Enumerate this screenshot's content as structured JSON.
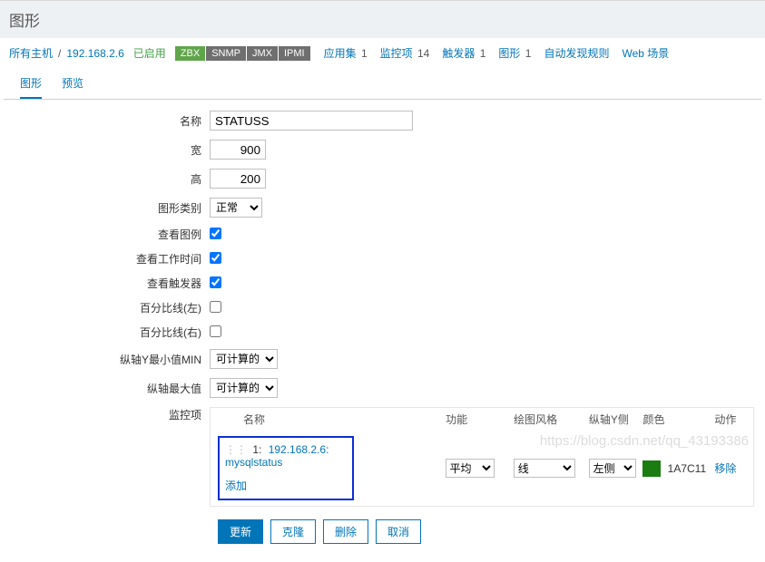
{
  "page": {
    "title": "图形"
  },
  "breadcrumb": {
    "all_hosts": "所有主机",
    "host": "192.168.2.6",
    "enabled": "已启用",
    "proto": {
      "zbx": "ZBX",
      "snmp": "SNMP",
      "jmx": "JMX",
      "ipmi": "IPMI"
    },
    "navs": [
      {
        "label": "应用集",
        "count": "1"
      },
      {
        "label": "监控项",
        "count": "14"
      },
      {
        "label": "触发器",
        "count": "1"
      },
      {
        "label": "图形",
        "count": "1"
      },
      {
        "label": "自动发现规则",
        "count": ""
      },
      {
        "label": "Web 场景",
        "count": ""
      }
    ]
  },
  "tabs": {
    "graph": "图形",
    "preview": "预览"
  },
  "form": {
    "name_label": "名称",
    "name_value": "STATUSS",
    "width_label": "宽",
    "width_value": "900",
    "height_label": "高",
    "height_value": "200",
    "type_label": "图形类别",
    "type_value": "正常",
    "show_legend_label": "查看图例",
    "show_worktime_label": "查看工作时间",
    "show_triggers_label": "查看触发器",
    "percent_left_label": "百分比线(左)",
    "percent_right_label": "百分比线(右)",
    "yaxis_min_label": "纵轴Y最小值MIN",
    "yaxis_min_value": "可计算的",
    "yaxis_max_label": "纵轴最大值",
    "yaxis_max_value": "可计算的",
    "items_label": "监控项"
  },
  "items": {
    "headers": {
      "name": "名称",
      "func": "功能",
      "style": "绘图风格",
      "yaxis": "纵轴Y侧",
      "color": "颜色",
      "action": "动作"
    },
    "rows": [
      {
        "index": "1:",
        "name": "192.168.2.6: mysqlstatus",
        "func": "平均",
        "style": "线",
        "yaxis": "左侧",
        "color_code": "1A7C11",
        "remove": "移除"
      }
    ],
    "add": "添加"
  },
  "buttons": {
    "update": "更新",
    "clone": "克隆",
    "delete": "删除",
    "cancel": "取消"
  },
  "watermark": "https://blog.csdn.net/qq_43193386"
}
